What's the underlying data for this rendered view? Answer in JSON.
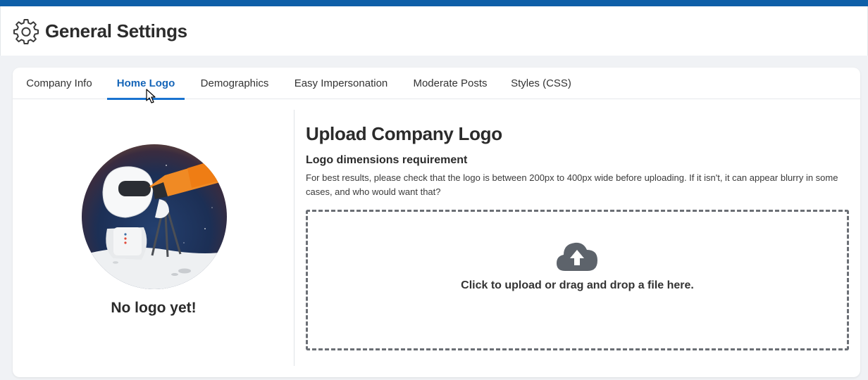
{
  "header": {
    "title": "General Settings",
    "icon": "gear-icon"
  },
  "tabs": [
    {
      "label": "Company Info",
      "active": false
    },
    {
      "label": "Home Logo",
      "active": true
    },
    {
      "label": "Demographics",
      "active": false
    },
    {
      "label": "Easy Impersonation",
      "active": false
    },
    {
      "label": "Moderate Posts",
      "active": false
    },
    {
      "label": "Styles (CSS)",
      "active": false
    }
  ],
  "preview": {
    "illustration": "astronaut-telescope-illustration",
    "empty_text": "No logo yet!"
  },
  "upload": {
    "title": "Upload Company Logo",
    "requirement_title": "Logo dimensions requirement",
    "requirement_text": "For best results, please check that the logo is between 200px to 400px wide before uploading. If it isn't, it can appear blurry in some cases, and who would want that?",
    "dropzone_icon": "cloud-upload-icon",
    "dropzone_text": "Click to upload or drag and drop a file here."
  },
  "colors": {
    "brand": "#0e5fa8",
    "active_tab": "#1565b8",
    "dropzone_border": "#6b6f75"
  }
}
